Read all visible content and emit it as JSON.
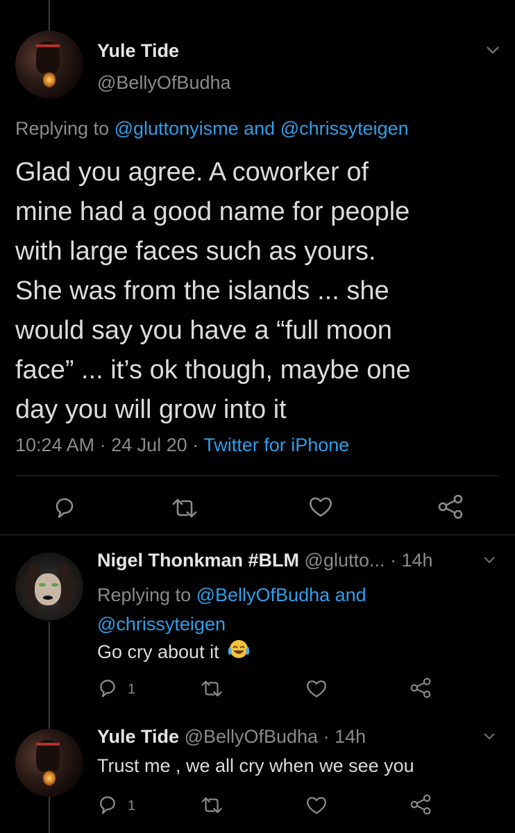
{
  "main_tweet": {
    "author_name": "Yule Tide",
    "author_handle": "@BellyOfBudha",
    "replying_prefix": "Replying to",
    "replying_user1": "@gluttonyisme",
    "replying_and": "and",
    "replying_user2": "@chrissyteigen",
    "body_lines": [
      "Glad you agree. A coworker of",
      "mine had a good name for people",
      "with large faces such as yours.",
      "She was from the islands ... she",
      "would say you have a “full moon",
      "face” ... it’s ok though, maybe one",
      "day you will grow into it"
    ],
    "time": "10:24 AM",
    "sep1": "·",
    "date": "24 Jul 20",
    "sep2": "·",
    "source": "Twitter for iPhone"
  },
  "reply1": {
    "author_name": "Nigel Thonkman #BLM",
    "author_handle": "@glutto...",
    "time": "· 14h",
    "replying_prefix": "Replying to",
    "replying_user1": "@BellyOfBudha",
    "replying_and": "and",
    "replying_user2": "@chrissyteigen",
    "body": "Go cry about it",
    "reply_count": "1"
  },
  "reply2": {
    "author_name": "Yule Tide",
    "author_handle": "@BellyOfBudha",
    "time": "· 14h",
    "body": "Trust me , we all cry when we see you",
    "reply_count": "1"
  },
  "icons": {
    "reply": "reply-icon",
    "retweet": "retweet-icon",
    "like": "heart-icon",
    "share": "share-icon",
    "caret": "chevron-down-icon",
    "emoji": "face-with-tears-of-joy-emoji"
  },
  "colors": {
    "background": "#000000",
    "link": "#2f9fea",
    "muted": "#8b8b8b",
    "text": "#dcdcdc"
  }
}
